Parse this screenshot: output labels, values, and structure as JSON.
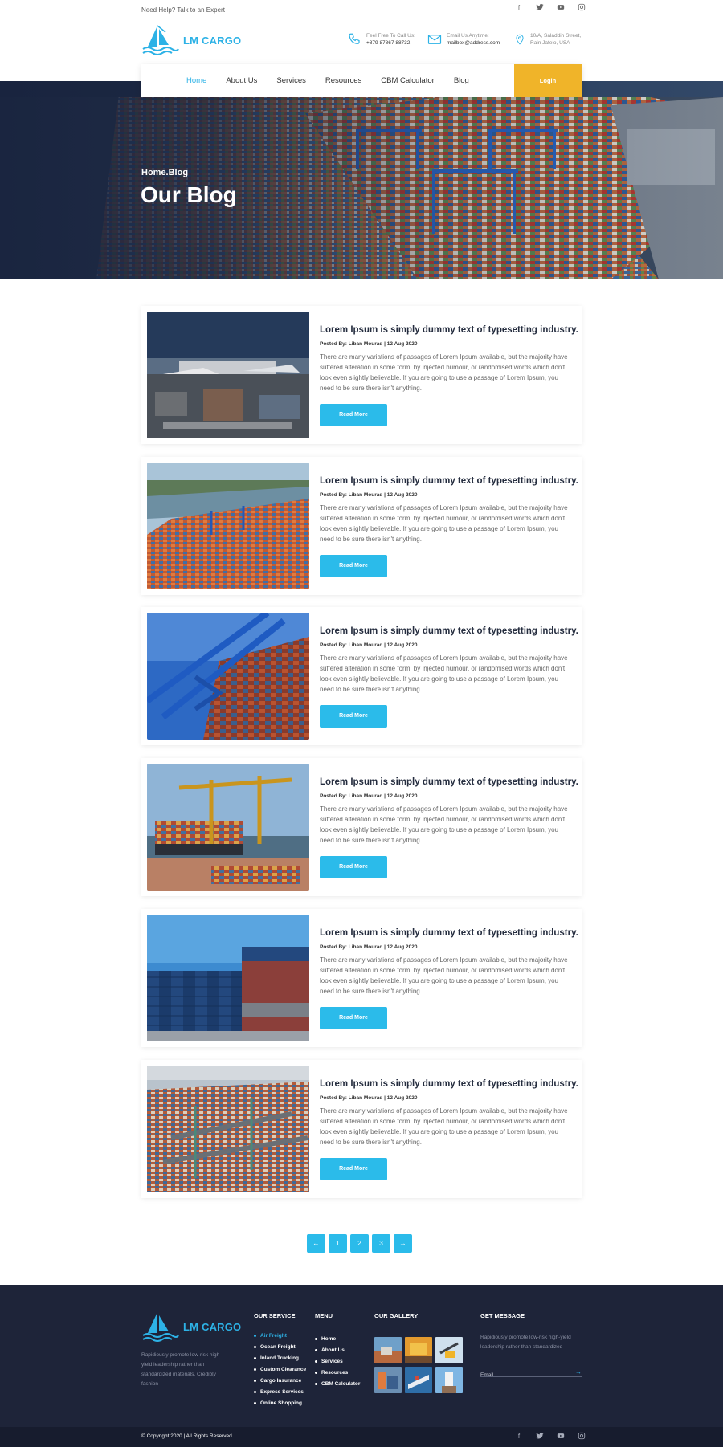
{
  "topbar": {
    "help_text": "Need Help? Talk to an Expert",
    "socials": [
      "facebook-icon",
      "twitter-icon",
      "youtube-icon",
      "instagram-icon"
    ]
  },
  "brand": {
    "name": "LM CARGO",
    "accent": "#2db2e6"
  },
  "contacts": [
    {
      "icon": "phone-icon",
      "label": "Feel Free To Call Us:",
      "value": "+879 87867 88732"
    },
    {
      "icon": "mail-icon",
      "label": "Email Us Anytime:",
      "value": "mailbox@address.com"
    },
    {
      "icon": "location-icon",
      "label": "10/A, Saladdin Street,",
      "value": "Rain Jafelo, USA"
    }
  ],
  "nav": {
    "items": [
      "Home",
      "About Us",
      "Services",
      "Resources",
      "CBM Calculator",
      "Blog"
    ],
    "active": "Home",
    "login": "Login",
    "login_color": "#f0b429"
  },
  "hero": {
    "breadcrumb": "Home.Blog",
    "title": "Our Blog"
  },
  "posts": [
    {
      "title": "Lorem Ipsum is simply dummy text of typesetting industry.",
      "meta": "Posted By: Liban Mourad | 12 Aug 2020",
      "body": "There are many variations of passages of Lorem Ipsum available, but the majority have suffered alteration in some form, by injected humour, or randomised words which don't look even slightly believable. If you are going to use a passage of Lorem Ipsum, you need to be sure there isn't anything.",
      "button": "Read More"
    },
    {
      "title": "Lorem Ipsum is simply dummy text of typesetting industry.",
      "meta": "Posted By: Liban Mourad | 12 Aug 2020",
      "body": "There are many variations of passages of Lorem Ipsum available, but the majority have suffered alteration in some form, by injected humour, or randomised words which don't look even slightly believable. If you are going to use a passage of Lorem Ipsum, you need to be sure there isn't anything.",
      "button": "Read More"
    },
    {
      "title": "Lorem Ipsum is simply dummy text of typesetting industry.",
      "meta": "Posted By: Liban Mourad | 12 Aug 2020",
      "body": "There are many variations of passages of Lorem Ipsum available, but the majority have suffered alteration in some form, by injected humour, or randomised words which don't look even slightly believable. If you are going to use a passage of Lorem Ipsum, you need to be sure there isn't anything.",
      "button": "Read More"
    },
    {
      "title": "Lorem Ipsum is simply dummy text of typesetting industry.",
      "meta": "Posted By: Liban Mourad | 12 Aug 2020",
      "body": "There are many variations of passages of Lorem Ipsum available, but the majority have suffered alteration in some form, by injected humour, or randomised words which don't look even slightly believable. If you are going to use a passage of Lorem Ipsum, you need to be sure there isn't anything.",
      "button": "Read More"
    },
    {
      "title": "Lorem Ipsum is simply dummy text of typesetting industry.",
      "meta": "Posted By: Liban Mourad | 12 Aug 2020",
      "body": "There are many variations of passages of Lorem Ipsum available, but the majority have suffered alteration in some form, by injected humour, or randomised words which don't look even slightly believable. If you are going to use a passage of Lorem Ipsum, you need to be sure there isn't anything.",
      "button": "Read More"
    },
    {
      "title": "Lorem Ipsum is simply dummy text of typesetting industry.",
      "meta": "Posted By: Liban Mourad | 12 Aug 2020",
      "body": "There are many variations of passages of Lorem Ipsum available, but the majority have suffered alteration in some form, by injected humour, or randomised words which don't look even slightly believable. If you are going to use a passage of Lorem Ipsum, you need to be sure there isn't anything.",
      "button": "Read More"
    }
  ],
  "pagination": {
    "prev": "←",
    "pages": [
      "1",
      "2",
      "3"
    ],
    "next": "→"
  },
  "footer": {
    "about": "Rapidiously promote low-risk high-yield leadership rather than standardized materials. Credibly fashion",
    "service_heading": "OUR SERVICE",
    "services": [
      "Air Freight",
      "Ocean Freight",
      "Inland Trucking",
      "Custom Clearance",
      "Cargo Insurance",
      "Express Services",
      "Online Shopping"
    ],
    "menu_heading": "MENU",
    "menu": [
      "Home",
      "About Us",
      "Services",
      "Resources",
      "CBM Calculator"
    ],
    "gallery_heading": "OUR GALLERY",
    "message_heading": "GET MESSAGE",
    "message_text": "Rapidiously promote low-risk high-yield leadership rather than standardized",
    "email_placeholder": "Email",
    "copyright": "© Copyright 2020 | All Rights Reserved"
  }
}
